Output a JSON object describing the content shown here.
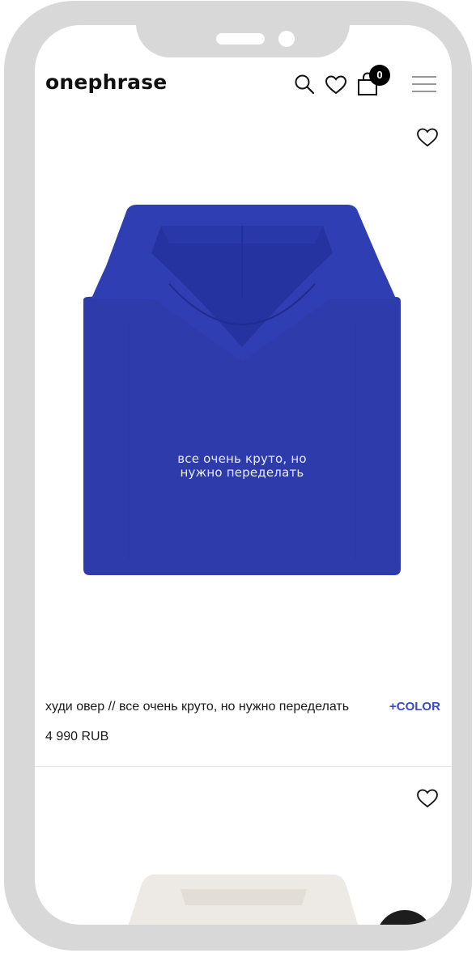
{
  "header": {
    "logo": "onephrase",
    "cart_count": "0",
    "icons": [
      "search-icon",
      "heart-icon",
      "bag-icon",
      "menu-icon"
    ]
  },
  "products": [
    {
      "image_text": "все очень круто, но нужно переделать",
      "image_text_line1": "все очень круто, но",
      "image_text_line2": "нужно переделать",
      "title": "худи овер // все очень круто, но нужно переделать",
      "color_link": "+COLOR",
      "price": "4 990 RUB",
      "color": "#2d3bab"
    },
    {
      "color": "#ede9e4"
    }
  ],
  "colors": {
    "frame": "#d8d8d8",
    "accent": "#3948c6",
    "divider": "#e5e5e5"
  }
}
